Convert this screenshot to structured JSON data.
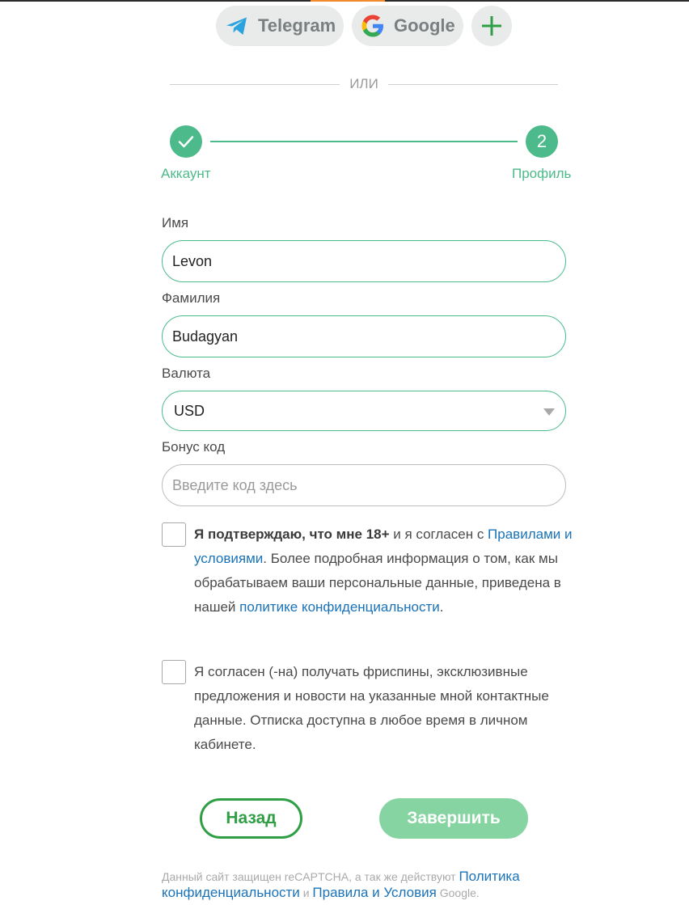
{
  "social": {
    "telegram_label": "Telegram",
    "google_label": "Google"
  },
  "divider_text": "ИЛИ",
  "stepper": {
    "step1_label": "Аккаунт",
    "step2_number": "2",
    "step2_label": "Профиль"
  },
  "form": {
    "first_name_label": "Имя",
    "first_name_value": "Levon",
    "last_name_label": "Фамилия",
    "last_name_value": "Budagyan",
    "currency_label": "Валюта",
    "currency_value": "USD",
    "bonus_label": "Бонус код",
    "bonus_placeholder": "Введите код здесь"
  },
  "consent_age": {
    "bold": "Я подтверждаю, что мне 18+",
    "t1": " и я согласен с ",
    "link_rules": "Правилами и условиями",
    "t2": ". Более подробная информация о том, как мы обрабатываем ваши персональные данные, приведена в нашей ",
    "link_privacy": "политике конфиденциальности",
    "t3": "."
  },
  "consent_marketing": {
    "text": "Я согласен (-на) получать фриспины, эксклюзивные предложения и новости на указанные мной контактные данные. Отписка доступна в любое время в личном кабинете."
  },
  "buttons": {
    "back": "Назад",
    "finish": "Завершить"
  },
  "footer": {
    "t1": "Данный сайт защищен reCAPTCHA, а так же действуют ",
    "link_privacy": "Политика конфиденциальности",
    "t2": " и ",
    "link_terms": "Правила и Условия",
    "t3": " Google."
  },
  "colors": {
    "accent_green": "#4cba8a",
    "button_green": "#2f9e44",
    "link_blue": "#1a73b8"
  },
  "icons": [
    "telegram-icon",
    "google-icon",
    "plus-icon",
    "check-icon",
    "dropdown-caret-icon"
  ]
}
